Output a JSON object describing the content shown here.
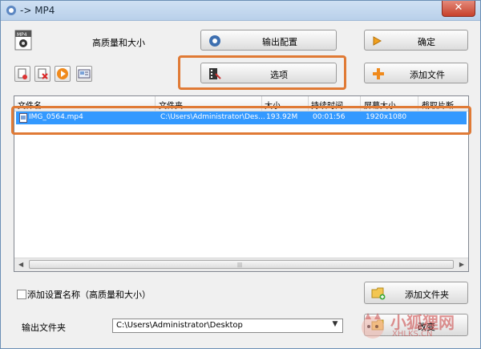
{
  "window": {
    "title": "-> MP4",
    "close_symbol": "✕"
  },
  "format": {
    "badge": "MP4",
    "quality_label": "高质量和大小"
  },
  "buttons": {
    "output_config": "输出配置",
    "ok": "确定",
    "options": "选项",
    "add_file": "添加文件",
    "add_folder": "添加文件夹",
    "change": "改变"
  },
  "table": {
    "columns": [
      "文件名",
      "文件夹",
      "大小",
      "持续时间",
      "屏幕大小",
      "截取片断"
    ],
    "rows": [
      {
        "file_name": "IMG_0564.mp4",
        "folder": "C:\\Users\\Administrator\\Des...",
        "size": "193.92M",
        "duration": "00:01:56",
        "screen_size": "1920x1080",
        "clip": ""
      }
    ],
    "scroll_grip": "|||"
  },
  "bottom": {
    "add_settings_name": "添加设置名称（高质量和大小）",
    "add_settings_checked": false,
    "output_folder_label": "输出文件夹",
    "output_folder_value": "C:\\Users\\Administrator\\Desktop"
  },
  "watermark": {
    "line1": "小狐狸网",
    "line2": "XHLKS.CN"
  },
  "colors": {
    "highlight": "#e07a35",
    "selection": "#3399ff"
  }
}
